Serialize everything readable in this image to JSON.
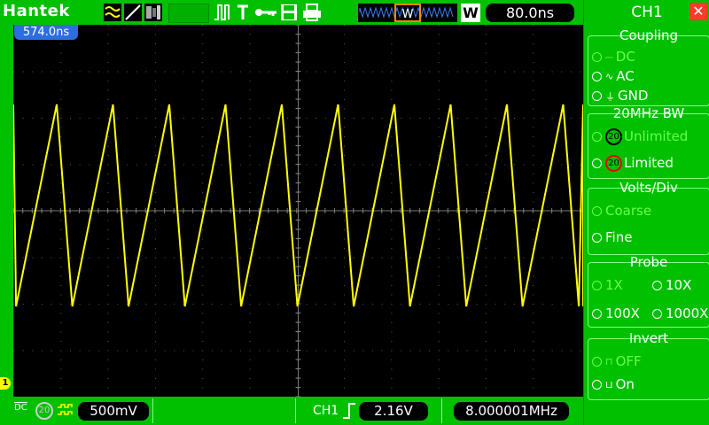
{
  "brand": "Hantek",
  "timebase": "80.0ns",
  "trigger_position": "574.0ns",
  "acquire_mode": "W",
  "menu": {
    "title": "CH1",
    "close_glyph": "✕",
    "sections": [
      {
        "title": "Coupling",
        "options": [
          {
            "label": "DC",
            "glyph": "DC",
            "active": false
          },
          {
            "label": "AC",
            "glyph": "AC",
            "active": true
          },
          {
            "label": "GND",
            "glyph": "⏚",
            "active": true
          }
        ]
      },
      {
        "title": "20MHz BW",
        "options": [
          {
            "label": "Unlimited",
            "active": false
          },
          {
            "label": "Limited",
            "active": true
          }
        ]
      },
      {
        "title": "Volts/Div",
        "options": [
          {
            "label": "Coarse",
            "active": false
          },
          {
            "label": "Fine",
            "active": true
          }
        ]
      },
      {
        "title": "Probe",
        "options": [
          {
            "label": "1X",
            "active": false
          },
          {
            "label": "10X",
            "active": true
          },
          {
            "label": "100X",
            "active": true
          },
          {
            "label": "1000X",
            "active": true
          }
        ]
      },
      {
        "title": "Invert",
        "options": [
          {
            "label": "OFF",
            "active": false
          },
          {
            "label": "On",
            "active": true
          }
        ]
      }
    ]
  },
  "bottom": {
    "coupling_glyph": "DC",
    "bw_glyph": "20",
    "volts_div": "500mV",
    "trigger_source": "CH1",
    "trigger_level": "2.16V",
    "frequency": "8.000001MHz"
  },
  "markers": {
    "ch1": "1"
  },
  "colors": {
    "trace": "#ffff00",
    "bg": "#00c000",
    "screen": "#000000",
    "accent": "#2c6de0"
  }
}
